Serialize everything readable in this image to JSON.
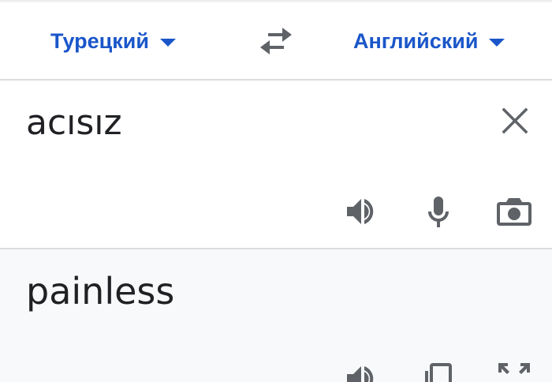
{
  "languages": {
    "source": "Турецкий",
    "target": "Английский",
    "swap_icon": "swap-horiz-icon",
    "dropdown_icon": "caret-down-icon"
  },
  "source": {
    "text": "acısız",
    "clear_icon": "close-icon",
    "actions": [
      "speaker-icon",
      "microphone-icon",
      "camera-icon"
    ]
  },
  "result": {
    "text": "painless",
    "actions": [
      "speaker-icon",
      "copy-icon",
      "fullscreen-icon"
    ]
  },
  "colors": {
    "accent": "#1a56c9",
    "icon": "#5f6368",
    "divider": "#dadce0",
    "result_bg": "#f8f9fa"
  }
}
